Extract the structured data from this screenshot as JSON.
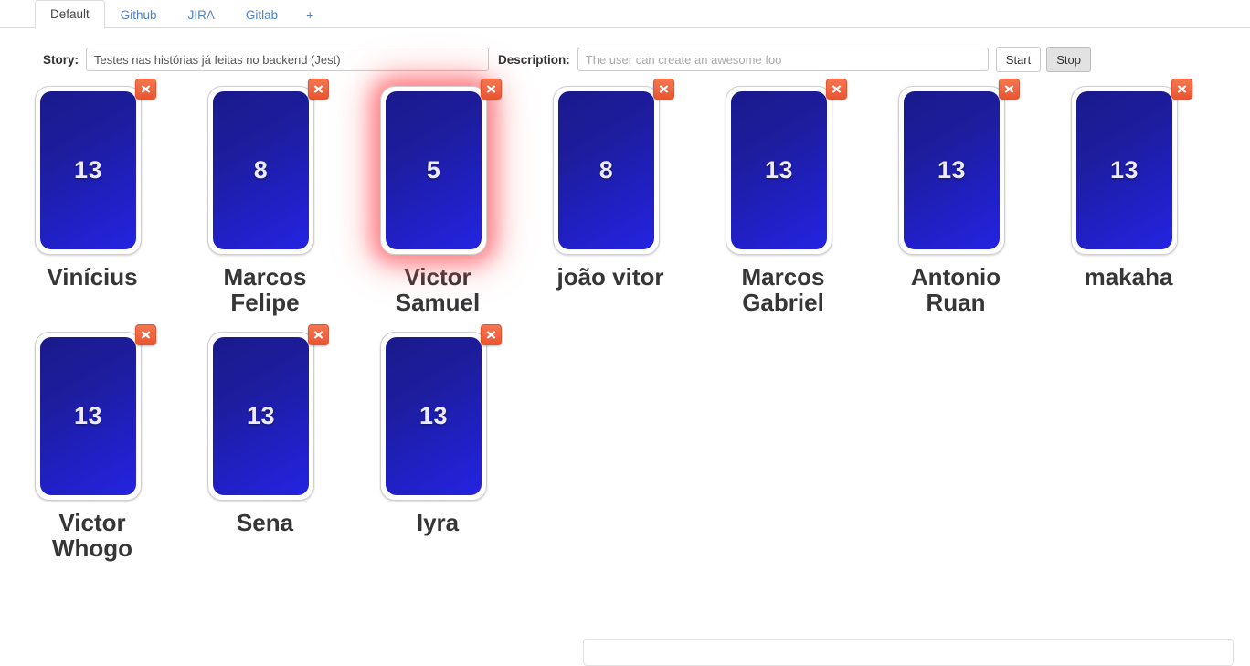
{
  "tabs": [
    {
      "label": "Default",
      "active": true
    },
    {
      "label": "Github",
      "active": false
    },
    {
      "label": "JIRA",
      "active": false
    },
    {
      "label": "Gitlab",
      "active": false
    },
    {
      "label": "+",
      "active": false
    }
  ],
  "form": {
    "story_label": "Story:",
    "story_value": "Testes nas histórias já feitas no backend (Jest)",
    "story_placeholder": "",
    "description_label": "Description:",
    "description_value": "",
    "description_placeholder": "The user can create an awesome foo",
    "start_label": "Start",
    "stop_label": "Stop"
  },
  "colors": {
    "card_gradient_start": "#1a1a8c",
    "card_gradient_end": "#2424e2",
    "delete_button": "#ef6744",
    "selection_glow": "#ff3c46",
    "tab_link": "#4f81c7",
    "name_text": "#363636"
  },
  "cards": [
    {
      "name": "Vinícius",
      "value": "13",
      "selected": false,
      "delete_label": "×"
    },
    {
      "name": "Marcos Felipe",
      "value": "8",
      "selected": false,
      "delete_label": "×"
    },
    {
      "name": "Victor Samuel",
      "value": "5",
      "selected": true,
      "delete_label": "×"
    },
    {
      "name": "joão vitor",
      "value": "8",
      "selected": false,
      "delete_label": "×"
    },
    {
      "name": "Marcos Gabriel",
      "value": "13",
      "selected": false,
      "delete_label": "×"
    },
    {
      "name": "Antonio Ruan",
      "value": "13",
      "selected": false,
      "delete_label": "×"
    },
    {
      "name": "makaha",
      "value": "13",
      "selected": false,
      "delete_label": "×"
    },
    {
      "name": "Victor Whogo",
      "value": "13",
      "selected": false,
      "delete_label": "×"
    },
    {
      "name": "Sena",
      "value": "13",
      "selected": false,
      "delete_label": "×"
    },
    {
      "name": "Iyra",
      "value": "13",
      "selected": false,
      "delete_label": "×"
    }
  ]
}
